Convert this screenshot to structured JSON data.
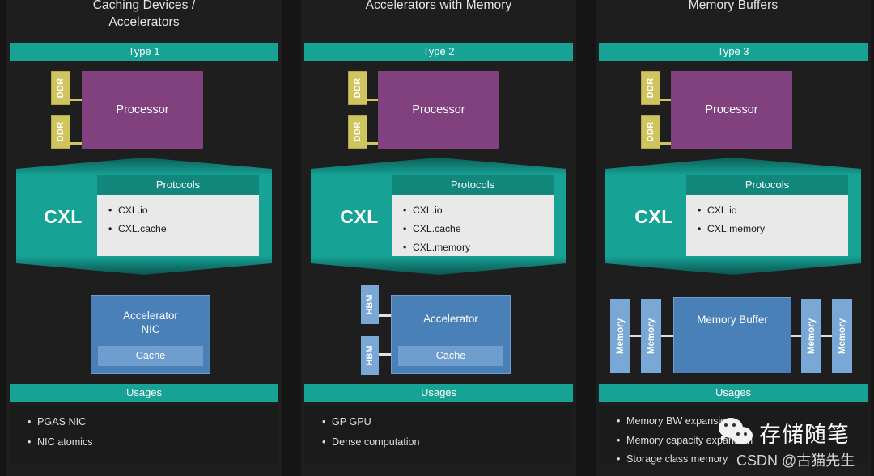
{
  "columns": [
    {
      "id": "type1",
      "title": "Caching Devices /\nAccelerators",
      "type_banner": "Type 1",
      "processor": "Processor",
      "ddr": [
        "DDR",
        "DDR"
      ],
      "cxl_label": "CXL",
      "protocols_header": "Protocols",
      "protocols": [
        "CXL.io",
        "CXL.cache"
      ],
      "device_title": "Accelerator\nNIC",
      "cache_label": "Cache",
      "usages_banner": "Usages",
      "usages": [
        "PGAS NIC",
        "NIC atomics"
      ]
    },
    {
      "id": "type2",
      "title": "Accelerators with Memory",
      "type_banner": "Type 2",
      "processor": "Processor",
      "ddr": [
        "DDR",
        "DDR"
      ],
      "cxl_label": "CXL",
      "protocols_header": "Protocols",
      "protocols": [
        "CXL.io",
        "CXL.cache",
        "CXL.memory"
      ],
      "device_title": "Accelerator",
      "cache_label": "Cache",
      "hbm": [
        "HBM",
        "HBM"
      ],
      "usages_banner": "Usages",
      "usages": [
        "GP GPU",
        "Dense computation"
      ]
    },
    {
      "id": "type3",
      "title": "Memory Buffers",
      "type_banner": "Type 3",
      "processor": "Processor",
      "ddr": [
        "DDR",
        "DDR"
      ],
      "cxl_label": "CXL",
      "protocols_header": "Protocols",
      "protocols": [
        "CXL.io",
        "CXL.memory"
      ],
      "device_title": "Memory Buffer",
      "memories": [
        "Memory",
        "Memory",
        "Memory",
        "Memory"
      ],
      "usages_banner": "Usages",
      "usages": [
        "Memory BW expansion",
        "Memory capacity expansion",
        "Storage class memory"
      ]
    }
  ],
  "watermark": {
    "title": "存储随笔",
    "subtitle": "CSDN @古猫先生"
  },
  "colors": {
    "background": "#151515",
    "panel": "#1e1e1e",
    "teal": "#16a294",
    "teal_dark": "#12887d",
    "processor_purple": "#80417e",
    "ddr_yellow": "#cfc45e",
    "device_blue": "#4a80b8",
    "memory_blue": "#79a7d6",
    "protocols_bg": "#e9e9e9"
  }
}
